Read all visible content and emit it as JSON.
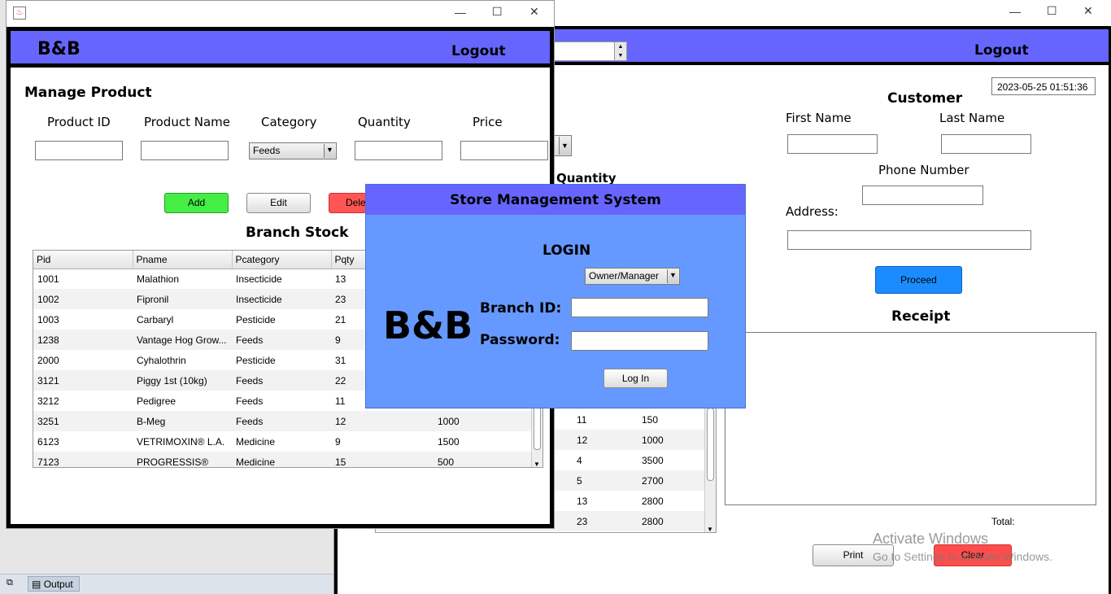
{
  "pos_window": {
    "header_logout": "Logout",
    "datetime": "2023-05-25 01:51:36",
    "quantity_label": "Quantity",
    "customer": {
      "title": "Customer",
      "first_name_label": "First Name",
      "last_name_label": "Last Name",
      "phone_label": "Phone Number",
      "address_label": "Address:",
      "proceed": "Proceed"
    },
    "receipt_title": "Receipt",
    "total_label": "Total:",
    "print": "Print",
    "clear": "Clear",
    "cart_rows": [
      {
        "q": "11",
        "p": "150"
      },
      {
        "q": "12",
        "p": "1000"
      },
      {
        "q": "4",
        "p": "3500"
      },
      {
        "q": "5",
        "p": "2700"
      },
      {
        "q": "13",
        "p": "2800"
      },
      {
        "q": "23",
        "p": "2800"
      }
    ]
  },
  "manage_window": {
    "brand": "B&B",
    "logout": "Logout",
    "title": "Manage Product",
    "labels": {
      "id": "Product ID",
      "name": "Product Name",
      "category": "Category",
      "quantity": "Quantity",
      "price": "Price"
    },
    "category_value": "Feeds",
    "buttons": {
      "add": "Add",
      "edit": "Edit",
      "delete": "Dele"
    },
    "stock_title": "Branch Stock",
    "columns": [
      "Pid",
      "Pname",
      "Pcategory",
      "Pqty"
    ],
    "rows": [
      [
        "1001",
        "Malathion",
        "Insecticide",
        "13",
        ""
      ],
      [
        "1002",
        "Fipronil",
        "Insecticide",
        "23",
        ""
      ],
      [
        "1003",
        "Carbaryl",
        "Pesticide",
        "21",
        ""
      ],
      [
        "1238",
        "Vantage Hog Grow...",
        "Feeds",
        "9",
        ""
      ],
      [
        "2000",
        "Cyhalothrin",
        "Pesticide",
        "31",
        ""
      ],
      [
        "3121",
        "Piggy 1st (10kg)",
        "Feeds",
        "22",
        ""
      ],
      [
        "3212",
        "Pedigree",
        "Feeds",
        "11",
        ""
      ],
      [
        "3251",
        "B-Meg",
        "Feeds",
        "12",
        "1000"
      ],
      [
        "6123",
        "VETRIMOXIN® L.A.",
        "Medicine",
        "9",
        "1500"
      ],
      [
        "7123",
        "PROGRESSIS®",
        "Medicine",
        "15",
        "500"
      ]
    ]
  },
  "login": {
    "title": "Store Management System",
    "heading": "LOGIN",
    "role": "Owner/Manager",
    "brand": "B&B",
    "branch_label": "Branch ID:",
    "password_label": "Password:",
    "login_button": "Log In"
  },
  "taskbar": {
    "output": "Output"
  },
  "watermark": {
    "line1": "Activate Windows",
    "line2": "Go to Settings to activate Windows."
  },
  "colors": {
    "header": "#6666ff",
    "login_bg": "#6699ff",
    "add": "#44ee44",
    "delete": "#ff5555",
    "proceed": "#1a8cff"
  }
}
